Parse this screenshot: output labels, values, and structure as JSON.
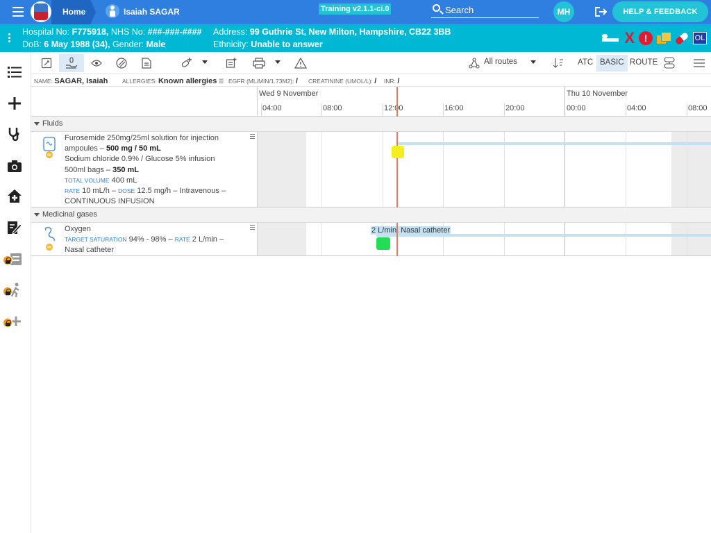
{
  "topbar": {
    "home_label": "Home",
    "patient_name": "Isaiah SAGAR",
    "version": "Training v2.1.1-ci.0",
    "search_label": "Search",
    "user_initials": "MH",
    "help_label": "HELP & FEEDBACK"
  },
  "banner": {
    "hospital_label": "Hospital No: ",
    "hospital_no": "F775918,",
    "nhs_label": " NHS No: ",
    "nhs_no": "###-###-####",
    "dob_label": "DoB: ",
    "dob": "6 May 1988 (34),",
    "gender_label": " Gender: ",
    "gender": "Male",
    "address_label": "Address: ",
    "address": "99 Guthrie St, New Milton, Hampshire, CB22 3BB",
    "ethnicity_label": "Ethnicity: ",
    "ethnicity": "Unable to answer",
    "ol_badge": "OL",
    "alert_x": "X",
    "alert_excl": "!"
  },
  "toolbar": {
    "routes_label": "All routes",
    "atc_label": "ATC",
    "basic_label": "BASIC",
    "route_label": "ROUTE"
  },
  "infostrip": {
    "name_label": "NAME",
    "name": "SAGAR, Isaiah",
    "allergies_label": "ALLERGIES",
    "allergies": "Known allergies",
    "egfr_label": "EGFR (ML/MIN/1.73M2)",
    "egfr": "/",
    "creatinine_label": "CREATININE (UMOL/L)",
    "creatinine": "/",
    "inr_label": "INR",
    "inr": "/"
  },
  "timeline": {
    "day1": "Wed 9 November",
    "day2": "Thu 10 November",
    "hours": [
      "04:00",
      "08:00",
      "12:00",
      "16:00",
      "20:00",
      "00:00",
      "04:00",
      "08:00"
    ]
  },
  "sections": {
    "fluids": "Fluids",
    "gases": "Medicinal gases"
  },
  "fluid_item": {
    "line1": "Furosemide 250mg/25ml solution for injection",
    "line2a": "ampoules – ",
    "line2b": "500 mg / 50 mL",
    "line3": "Sodium chloride 0.9% / Glucose 5% infusion",
    "line4a": "500ml bags – ",
    "line4b": "350 mL",
    "total_label": "TOTAL VOLUME",
    "total": "400 mL",
    "rate_label": "RATE",
    "rate": "10 mL/h –",
    "dose_label": "DOSE",
    "dose": "12.5 mg/h – Intravenous –",
    "mode": "CONTINUOUS INFUSION",
    "marker_color": "#f5ee1e"
  },
  "gas_item": {
    "name": "Oxygen",
    "target_label": "TARGET SATURATION",
    "target": "94% - 98% –",
    "rate_label": "RATE",
    "rate": "2 L/min –",
    "route": "Nasal catheter",
    "bar_label": "2 L/min, Nasal catheter",
    "marker_color": "#22dd55"
  }
}
